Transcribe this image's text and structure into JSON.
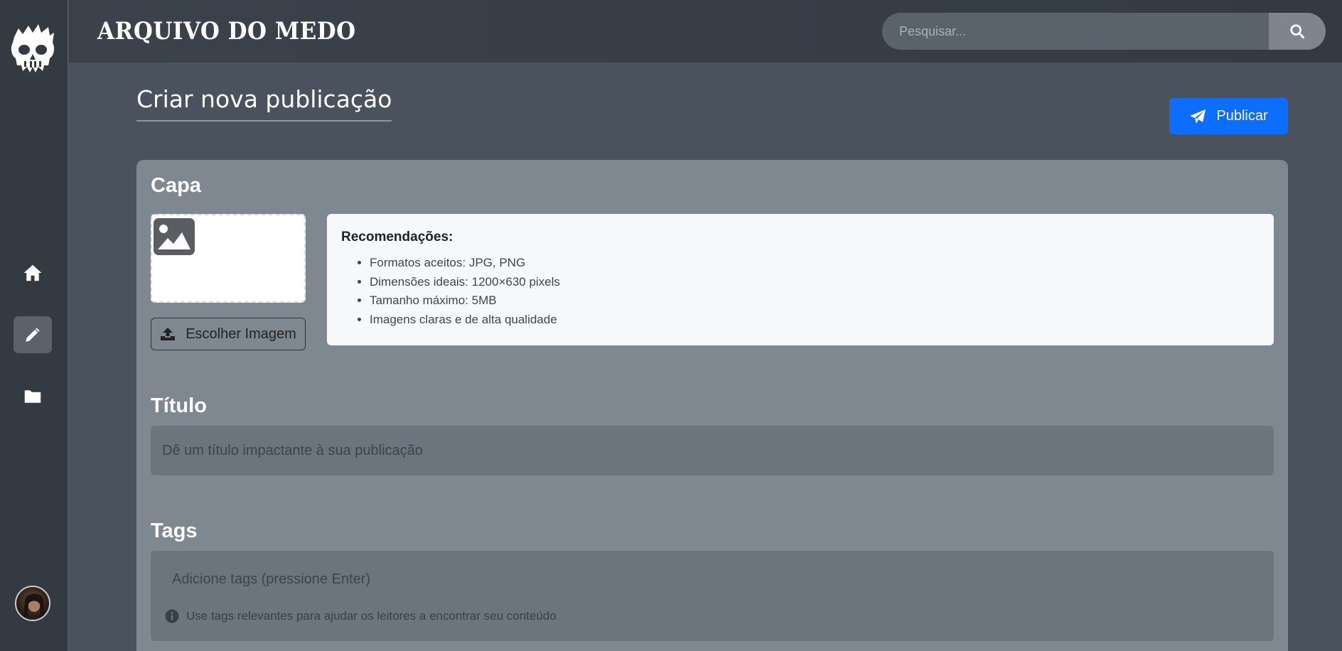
{
  "app": {
    "brand": "ARQUIVO DO MEDO"
  },
  "search": {
    "placeholder": "Pesquisar..."
  },
  "sidebar": {
    "items": [
      {
        "name": "home",
        "icon": "home-icon"
      },
      {
        "name": "edit",
        "icon": "pencil-icon",
        "active": true
      },
      {
        "name": "folder",
        "icon": "folder-icon"
      }
    ]
  },
  "page": {
    "title": "Criar nova publicação",
    "publish_label": "Publicar"
  },
  "cover": {
    "heading": "Capa",
    "choose_label": "Escolher Imagem",
    "reco_title": "Recomendações:",
    "reco_items": [
      "Formatos aceitos: JPG, PNG",
      "Dimensões ideais: 1200×630 pixels",
      "Tamanho máximo: 5MB",
      "Imagens claras e de alta qualidade"
    ]
  },
  "title_section": {
    "heading": "Título",
    "placeholder": "Dê um título impactante à sua publicação"
  },
  "tags_section": {
    "heading": "Tags",
    "placeholder": "Adicione tags (pressione Enter)",
    "hint": "Use tags relevantes para ajudar os leitores a encontrar seu conteúdo"
  },
  "colors": {
    "accent": "#0d6efd",
    "sidebar": "#343a42",
    "card": "#7f8891"
  }
}
